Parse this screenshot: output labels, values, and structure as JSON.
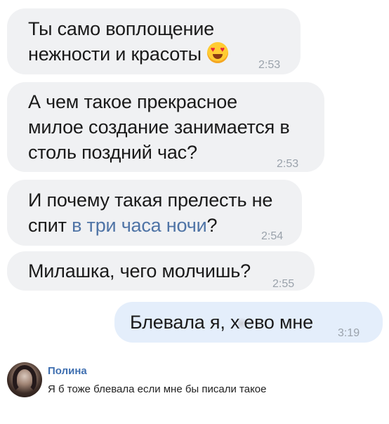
{
  "messages": [
    {
      "lines": [
        "Ты само воплощение",
        "нежности и красоты"
      ],
      "emoji": "heart-eyes-emoji",
      "time": "2:53"
    },
    {
      "lines": [
        "А чем такое прекрасное",
        "милое создание занимается в",
        "столь поздний час?"
      ],
      "time": "2:53"
    },
    {
      "line1": "И почему такая прелесть не",
      "line2_before": "спит ",
      "line2_link": "в три часа ночи",
      "line2_after": "?",
      "time": "2:54"
    },
    {
      "lines": [
        "Милашка, чего молчишь?"
      ],
      "time": "2:55"
    },
    {
      "text_before": "Блевала я, х",
      "text_after": "ево мне",
      "time": "3:19"
    }
  ],
  "comment": {
    "author": "Полина",
    "text": "Я б тоже блевала если мне бы писали такое"
  },
  "colors": {
    "incoming_bubble": "#f0f1f3",
    "outgoing_bubble": "#e4eefb",
    "link": "#4f74a6",
    "time": "#9aa2ab",
    "author": "#3f6fb0"
  }
}
